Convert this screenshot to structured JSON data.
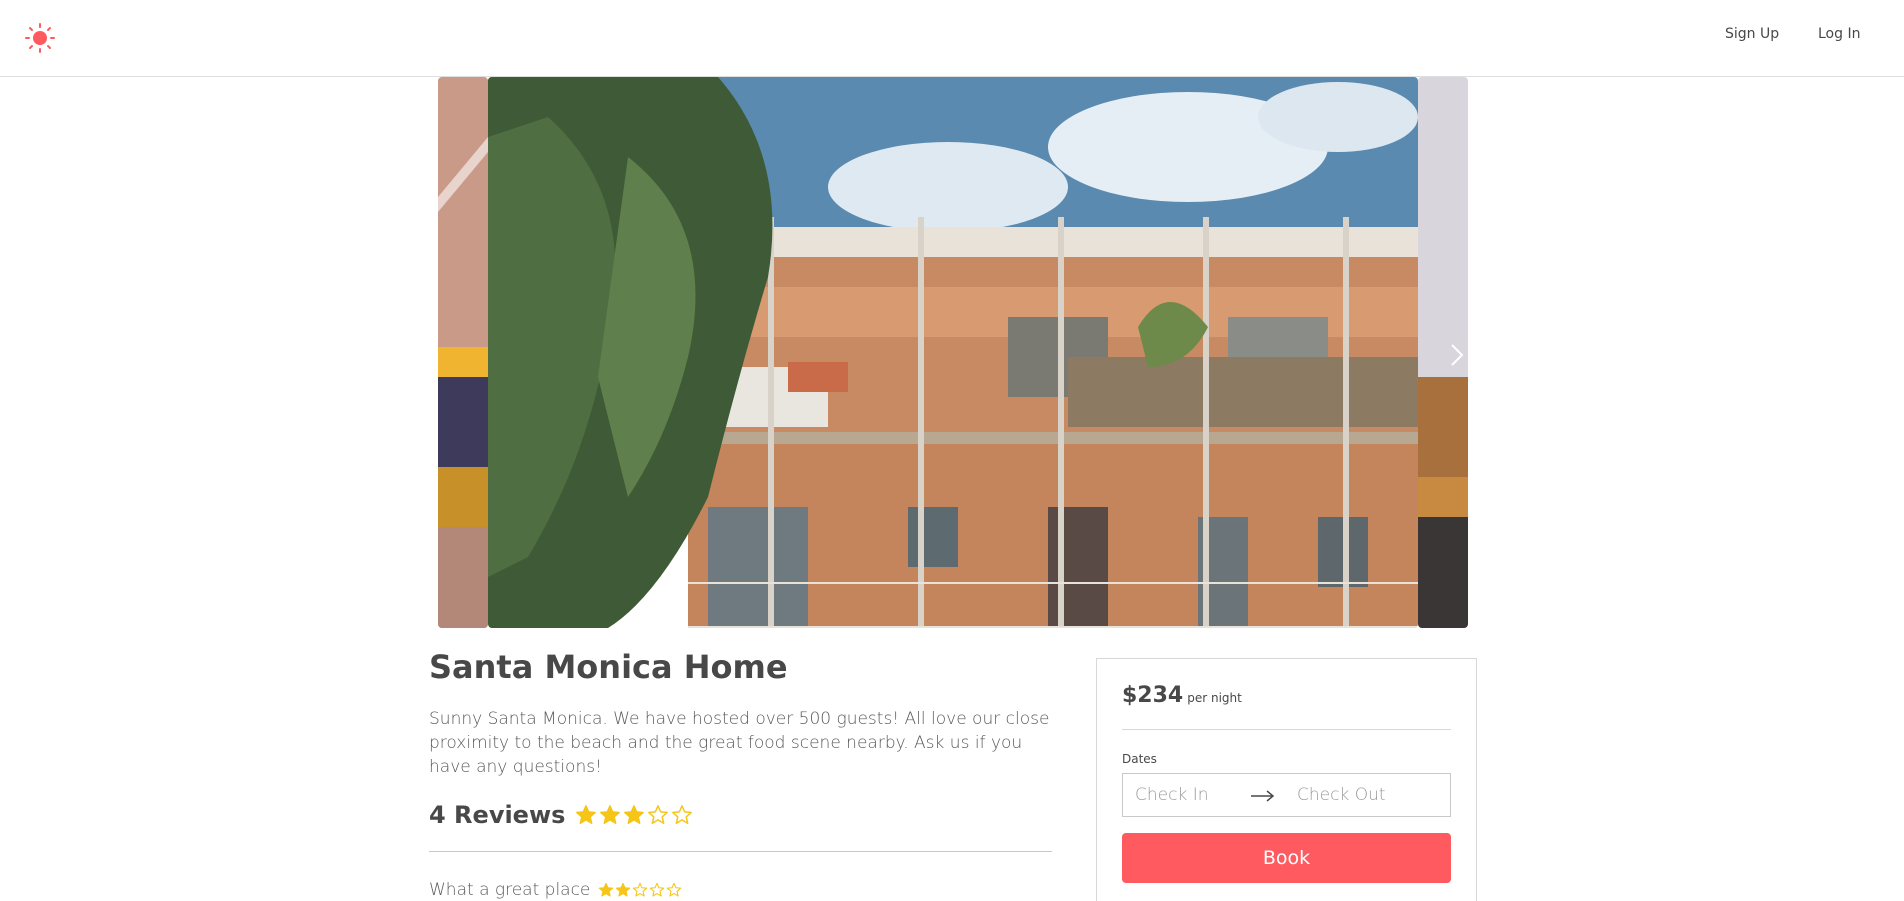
{
  "header": {
    "logo_icon": "sun-icon",
    "sign_up_label": "Sign Up",
    "log_in_label": "Log In"
  },
  "carousel": {
    "next_icon": "chevron-right-icon"
  },
  "listing": {
    "title": "Santa Monica Home",
    "description": "Sunny Santa Monica. We have hosted over 500 guests! All love our close proximity to the beach and the great food scene nearby. Ask us if you have any questions!",
    "reviews_title": "4 Reviews",
    "rating": 3,
    "rating_max": 5
  },
  "reviews": [
    {
      "text": "What a great place",
      "rating": 2,
      "rating_max": 5
    }
  ],
  "booking": {
    "price": "$234",
    "per_night": "per night",
    "dates_label": "Dates",
    "check_in_placeholder": "Check In",
    "check_out_placeholder": "Check Out",
    "book_label": "Book"
  },
  "colors": {
    "brand": "#ff5a5f",
    "star": "#f5c518",
    "text": "#484848"
  }
}
